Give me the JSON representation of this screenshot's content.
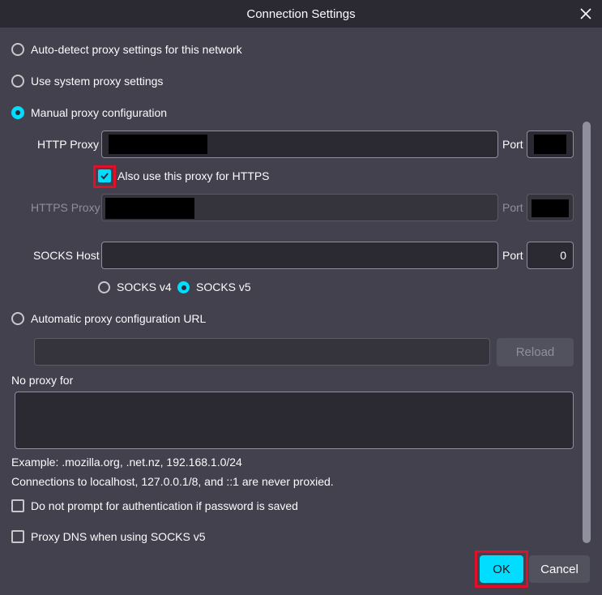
{
  "dialog": {
    "title": "Connection Settings"
  },
  "proxy_modes": {
    "auto_detect": "Auto-detect proxy settings for this network",
    "system": "Use system proxy settings",
    "manual": "Manual proxy configuration",
    "auto_url": "Automatic proxy configuration URL"
  },
  "manual": {
    "http_label": "HTTP Proxy",
    "port_label": "Port",
    "also_https_label": "Also use this proxy for HTTPS",
    "https_label": "HTTPS Proxy",
    "socks_label": "SOCKS Host",
    "socks_port_value": "0",
    "socks_v4": "SOCKS v4",
    "socks_v5": "SOCKS v5"
  },
  "auto_url": {
    "reload_label": "Reload"
  },
  "no_proxy": {
    "label": "No proxy for",
    "example": "Example: .mozilla.org, .net.nz, 192.168.1.0/24",
    "localhost_note": "Connections to localhost, 127.0.0.1/8, and ::1 are never proxied."
  },
  "options": {
    "no_prompt_auth": "Do not prompt for authentication if password is saved",
    "proxy_dns": "Proxy DNS when using SOCKS v5"
  },
  "buttons": {
    "ok": "OK",
    "cancel": "Cancel"
  },
  "colors": {
    "accent": "#00ddff",
    "highlight": "#e0102a"
  }
}
